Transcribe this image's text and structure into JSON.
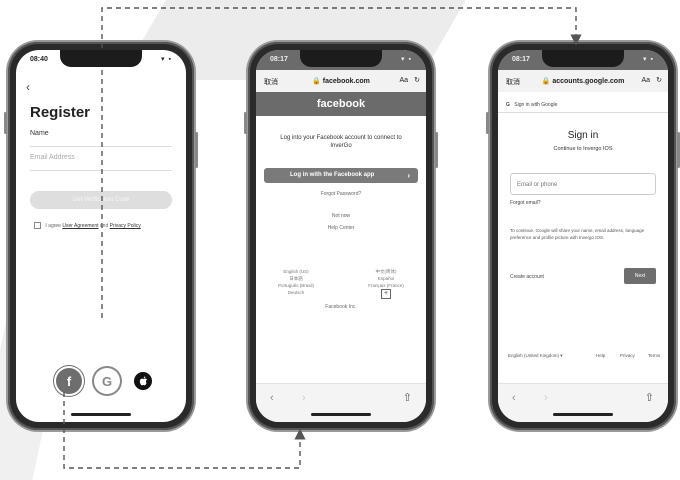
{
  "register_screen": {
    "status_time": "08:40",
    "status_icons": "▾ ▪",
    "back": "‹",
    "title": "Register",
    "name_placeholder": "Name",
    "email_placeholder": "Email Address",
    "next_button": "Get Verification Code",
    "agree_prefix": "I agree",
    "agree_terms": "User Agreement",
    "agree_and": "and",
    "agree_privacy": "Privacy Policy",
    "social_facebook": "f",
    "social_google": "G",
    "social_apple": ""
  },
  "facebook_screen": {
    "status_time": "08:17",
    "status_icons": "▾ ▪",
    "cancel": "取消",
    "url": "🔒 facebook.com",
    "aa": "Aa",
    "reload": "↻",
    "brand": "facebook",
    "message": "Log into your Facebook account to connect to InverGo",
    "login_button": "Log in with the Facebook app",
    "login_arrow": "›",
    "forgot_password": "Forgot Password?",
    "not_now": "Not now",
    "help_center": "Help Center",
    "lang_left": [
      "English (US)",
      "日本語",
      "Português (Brasil)",
      "Deutsch"
    ],
    "lang_right": [
      "中文(简体)",
      "Español",
      "Français (France)"
    ],
    "more_languages": "+",
    "company": "Facebook Inc.",
    "nav_back": "‹",
    "nav_forward": "›",
    "share": "⇧"
  },
  "google_screen": {
    "status_time": "08:17",
    "status_icons": "▾ ▪",
    "cancel": "取消",
    "url": "🔒 accounts.google.com",
    "aa": "Aa",
    "reload": "↻",
    "sign_in_with": "Sign in with Google",
    "g_logo": "G",
    "title": "Sign in",
    "subtitle": "Continue to Invergo IOS",
    "email_placeholder": "Email or phone",
    "forgot_email": "Forgot email?",
    "info": "To continue, Google will share your name, email address, language preference and profile picture with Invergo IOS.",
    "create_account": "Create account",
    "next_button": "Next",
    "footer_lang": "English (United Kingdom) ▾",
    "footer_help": "Help",
    "footer_privacy": "Privacy",
    "footer_terms": "Terms",
    "nav_back": "‹",
    "nav_forward": "›",
    "share": "⇧"
  }
}
